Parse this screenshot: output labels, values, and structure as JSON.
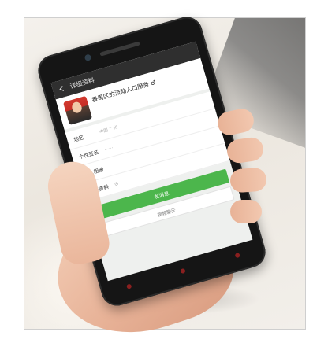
{
  "screen": {
    "header_title": "详细资料",
    "profile_name": "番禺区的流动人口服务 ♂",
    "rows": [
      {
        "label": "地区",
        "value": "中国 广州"
      },
      {
        "label": "个性签名",
        "value": "……"
      },
      {
        "label": "个人相册",
        "value": ""
      },
      {
        "label": "社交资料",
        "value": ""
      }
    ],
    "primary_button": "发消息",
    "secondary_button": "视频聊天"
  },
  "colors": {
    "accent_green": "#4cb64c",
    "topbar": "#2f2f2f",
    "phone_body": "#151515"
  },
  "icons": {
    "back": "back-arrow-icon",
    "gender": "male-icon",
    "sns": "social-icon"
  }
}
